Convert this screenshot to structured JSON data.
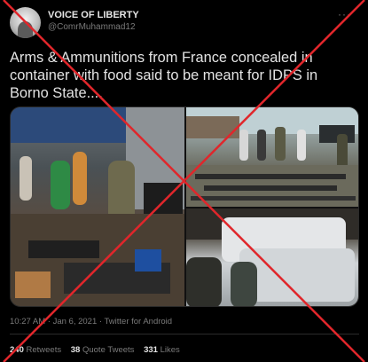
{
  "author": {
    "name": "VOICE OF LIBERTY",
    "handle": "@ComrMuhammad12"
  },
  "more_icon": "more-dots-icon",
  "tweet_text": "Arms & Ammunitions from France concealed in container with food said to be meant for IDPS in Borno State....",
  "meta": {
    "time_and_source": "10:27 AM · Jan 6, 2021 · Twitter for Android"
  },
  "stats": {
    "retweets_count": "240",
    "retweets_label": "Retweets",
    "quotes_count": "38",
    "quotes_label": "Quote Tweets",
    "likes_count": "331",
    "likes_label": "Likes"
  },
  "overlay": {
    "type": "red-cross",
    "color": "#e0262b"
  }
}
